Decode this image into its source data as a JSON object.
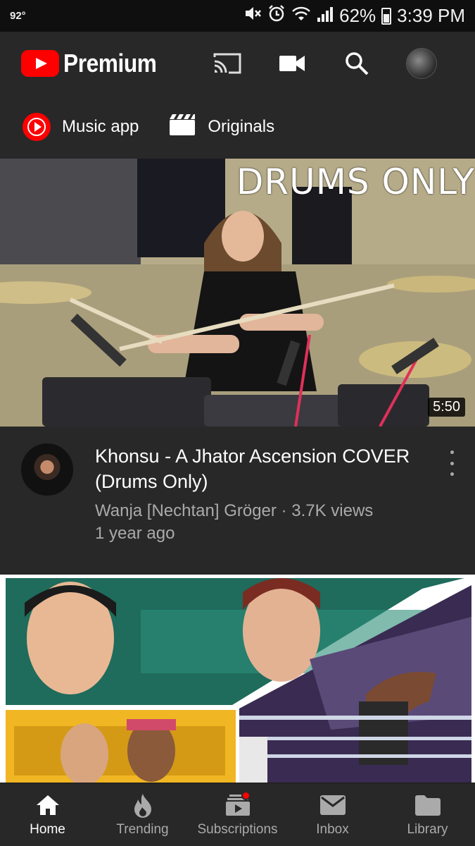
{
  "status_bar": {
    "temperature": "92°",
    "battery_percent": "62%",
    "battery_level": 0.62,
    "time": "3:39 PM",
    "icons": [
      "mute-icon",
      "alarm-icon",
      "wifi-icon",
      "signal-icon",
      "battery-icon"
    ]
  },
  "app_bar": {
    "brand": "Premium",
    "icons": [
      "cast-icon",
      "camera-icon",
      "search-icon",
      "account-avatar"
    ]
  },
  "chips": [
    {
      "label": "Music app",
      "icon": "music-app-icon"
    },
    {
      "label": "Originals",
      "icon": "clapperboard-icon"
    }
  ],
  "videos": [
    {
      "overlay_text": "DRUMS ONLY",
      "duration": "5:50",
      "title": "Khonsu - A Jhator Ascension COVER (Drums Only)",
      "channel": "Wanja [Nechtan] Gröger",
      "views": "3.7K views",
      "meta_line": "Wanja [Nechtan] Gröger · 3.7K views",
      "age": "1 year ago"
    }
  ],
  "bottom_nav": [
    {
      "label": "Home",
      "icon": "home-icon",
      "active": true
    },
    {
      "label": "Trending",
      "icon": "flame-icon",
      "active": false
    },
    {
      "label": "Subscriptions",
      "icon": "subscriptions-icon",
      "active": false,
      "badge": true
    },
    {
      "label": "Inbox",
      "icon": "mail-icon",
      "active": false
    },
    {
      "label": "Library",
      "icon": "folder-icon",
      "active": false
    }
  ],
  "colors": {
    "brand_red": "#ff0000",
    "background": "#212121",
    "surface": "#282828",
    "secondary_text": "#aaaaaa"
  }
}
